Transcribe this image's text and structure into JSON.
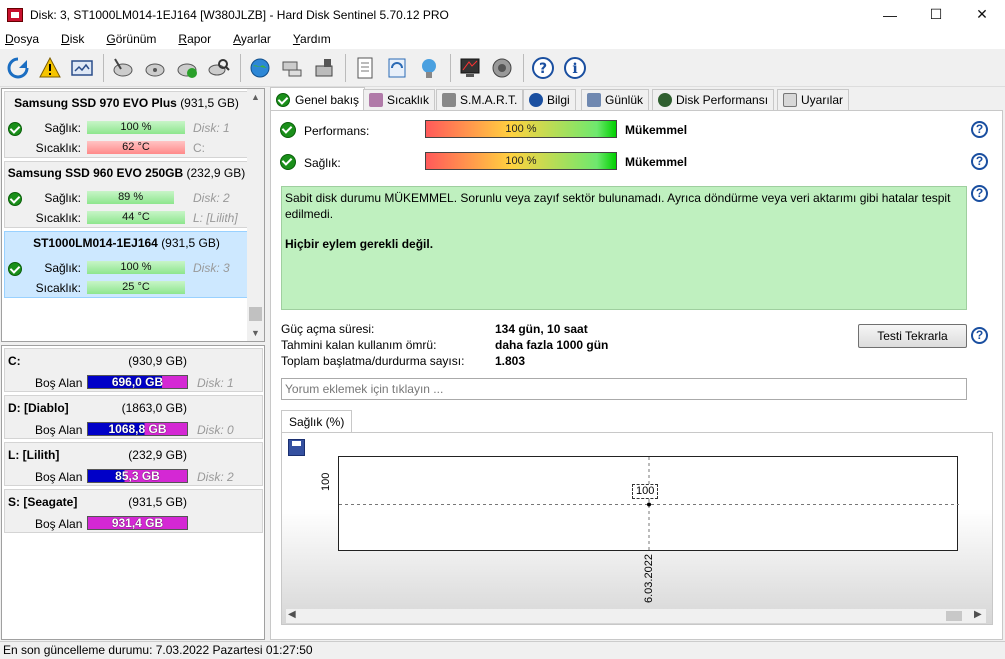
{
  "window": {
    "title": "Disk: 3, ST1000LM014-1EJ164 [W380JLZB]  -  Hard Disk Sentinel 5.70.12 PRO",
    "minimize": "—",
    "maximize": "☐",
    "close": "✕"
  },
  "menu": [
    {
      "u": "D",
      "rest": "osya"
    },
    {
      "u": "D",
      "rest": "isk"
    },
    {
      "u": "G",
      "rest": "örünüm"
    },
    {
      "u": "R",
      "rest": "apor"
    },
    {
      "u": "A",
      "rest": "yarlar"
    },
    {
      "u": "Y",
      "rest": "ardım"
    }
  ],
  "disks": [
    {
      "name": "Samsung SSD 970 EVO Plus",
      "size": "(931,5 GB)",
      "health_label": "Sağlık:",
      "health": "100 %",
      "health_pct": 100,
      "temp_label": "Sıcaklık:",
      "temp": "62 °C",
      "temp_hot": true,
      "disk_num": "Disk: 1",
      "drive": "C:",
      "selected": false
    },
    {
      "name": "Samsung SSD 960 EVO 250GB",
      "size": "(232,9 GB)",
      "health_label": "Sağlık:",
      "health": "89 %",
      "health_pct": 89,
      "temp_label": "Sıcaklık:",
      "temp": "44 °C",
      "temp_hot": false,
      "disk_num": "Disk: 2",
      "drive": "L: [Lilith]",
      "selected": false
    },
    {
      "name": "ST1000LM014-1EJ164",
      "size": "(931,5 GB)",
      "health_label": "Sağlık:",
      "health": "100 %",
      "health_pct": 100,
      "temp_label": "Sıcaklık:",
      "temp": "25 °C",
      "temp_hot": false,
      "disk_num": "Disk: 3",
      "drive": "",
      "selected": true
    }
  ],
  "volumes": [
    {
      "name": "C:",
      "size": "(930,9 GB)",
      "free_label": "Boş Alan",
      "free": "696,0 GB",
      "used_pct": 25,
      "disk": "Disk: 1"
    },
    {
      "name": "D: [Diablo]",
      "size": "(1863,0 GB)",
      "free_label": "Boş Alan",
      "free": "1068,8 GB",
      "used_pct": 43,
      "disk": "Disk: 0"
    },
    {
      "name": "L: [Lilith]",
      "size": "(232,9 GB)",
      "free_label": "Boş Alan",
      "free": "85,3 GB",
      "used_pct": 63,
      "disk": "Disk: 2"
    },
    {
      "name": "S: [Seagate]",
      "size": "(931,5 GB)",
      "free_label": "Boş Alan",
      "free": "931,4 GB",
      "used_pct": 0,
      "disk": ""
    }
  ],
  "tabs": [
    "Genel bakış",
    "Sıcaklık",
    "S.M.A.R.T.",
    "Bilgi",
    "Günlük",
    "Disk Performansı",
    "Uyarılar"
  ],
  "overview": {
    "performance_label": "Performans:",
    "performance_value": "100 %",
    "performance_rating": "Mükemmel",
    "health_label": "Sağlık:",
    "health_value": "100 %",
    "health_rating": "Mükemmel",
    "status_text": "Sabit disk durumu MÜKEMMEL. Sorunlu veya zayıf sektör bulunamadı. Ayrıca döndürme veya veri aktarımı gibi hatalar tespit edilmedi.",
    "action_text": "Hiçbir eylem gerekli değil.",
    "power_on_label": "Güç açma süresi:",
    "power_on_value": "134 gün, 10 saat",
    "lifetime_label": "Tahmini kalan kullanım ömrü:",
    "lifetime_value": "daha fazla 1000 gün",
    "start_stop_label": "Toplam başlatma/durdurma sayısı:",
    "start_stop_value": "1.803",
    "retest_button": "Testi Tekrarla",
    "comment_placeholder": "Yorum eklemek için tıklayın ..."
  },
  "chart_data": {
    "type": "line",
    "tab_label": "Sağlık (%)",
    "x": [
      "6.03.2022"
    ],
    "series": [
      {
        "values": [
          100
        ]
      }
    ],
    "y_tick": "100",
    "point_label": "100"
  },
  "status_bar": "En son güncelleme durumu: 7.03.2022 Pazartesi 01:27:50",
  "colors": {
    "accent_check": "#1a8f1a",
    "free_bar": "#0000c8",
    "used_bar": "#d428d4"
  }
}
